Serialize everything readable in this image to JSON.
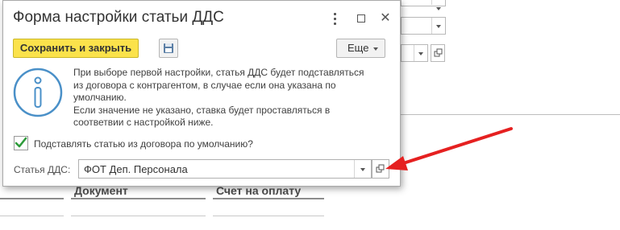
{
  "dialog": {
    "title": "Форма настройки статьи ДДС",
    "save_close_label": "Сохранить и закрыть",
    "more_label": "Еще",
    "info_text": [
      "При выборе первой настройки, статья ДДС будет подставляться",
      "из договора с контрагентом, в случае если она указана по",
      "умолчанию.",
      "Если значение не указано, ставка будет проставляться в",
      "соответвии с настройкой ниже."
    ],
    "checkbox": {
      "label": "Подставлять статью из договора по умолчанию?",
      "checked": true
    },
    "field": {
      "label": "Статья ДДС:",
      "value": "ФОТ Деп. Персонала"
    }
  },
  "background": {
    "table_headers": [
      "Документ",
      "Счет на оплату"
    ]
  },
  "colors": {
    "save_button_bg": "#fbe24b",
    "checkbox_mark": "#2e9b3b",
    "info_icon": "#4a90c8",
    "annotation_arrow": "#e52020"
  },
  "icons": {
    "menu": "more-vertical-icon",
    "maximize": "maximize-icon",
    "close": "close-icon",
    "save": "floppy-disk-icon",
    "info": "info-icon",
    "open": "open-in-window-icon"
  }
}
